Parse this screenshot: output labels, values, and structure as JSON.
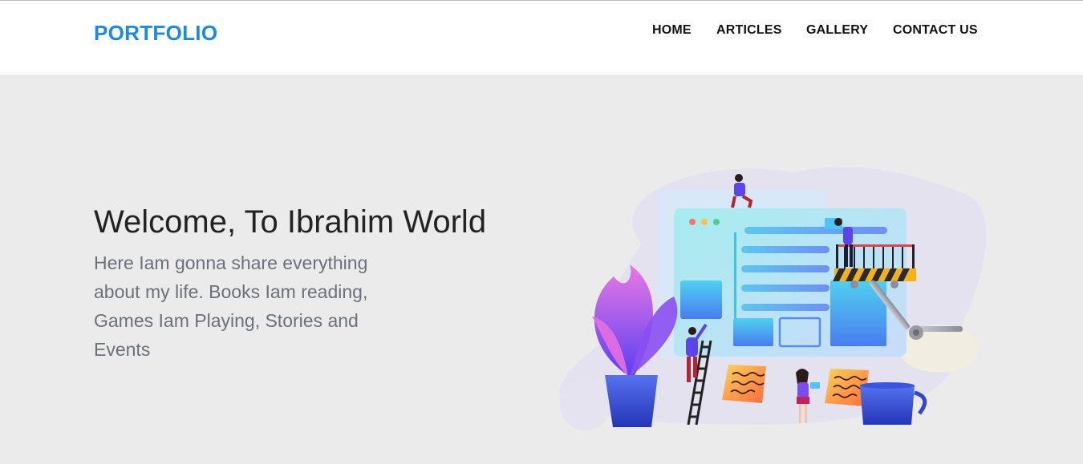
{
  "nav": {
    "brand": "PORTFOLIO",
    "links": [
      {
        "label": "HOME"
      },
      {
        "label": "ARTICLES"
      },
      {
        "label": "GALLERY"
      },
      {
        "label": "CONTACT US"
      }
    ]
  },
  "hero": {
    "title": "Welcome, To Ibrahim World",
    "description": "Here Iam gonna share everything about my life. Books Iam reading, Games Iam Playing, Stories and Events"
  },
  "colors": {
    "brand": "#1e88e5",
    "page_background": "#ebebeb",
    "navbar_background": "#ffffff"
  }
}
